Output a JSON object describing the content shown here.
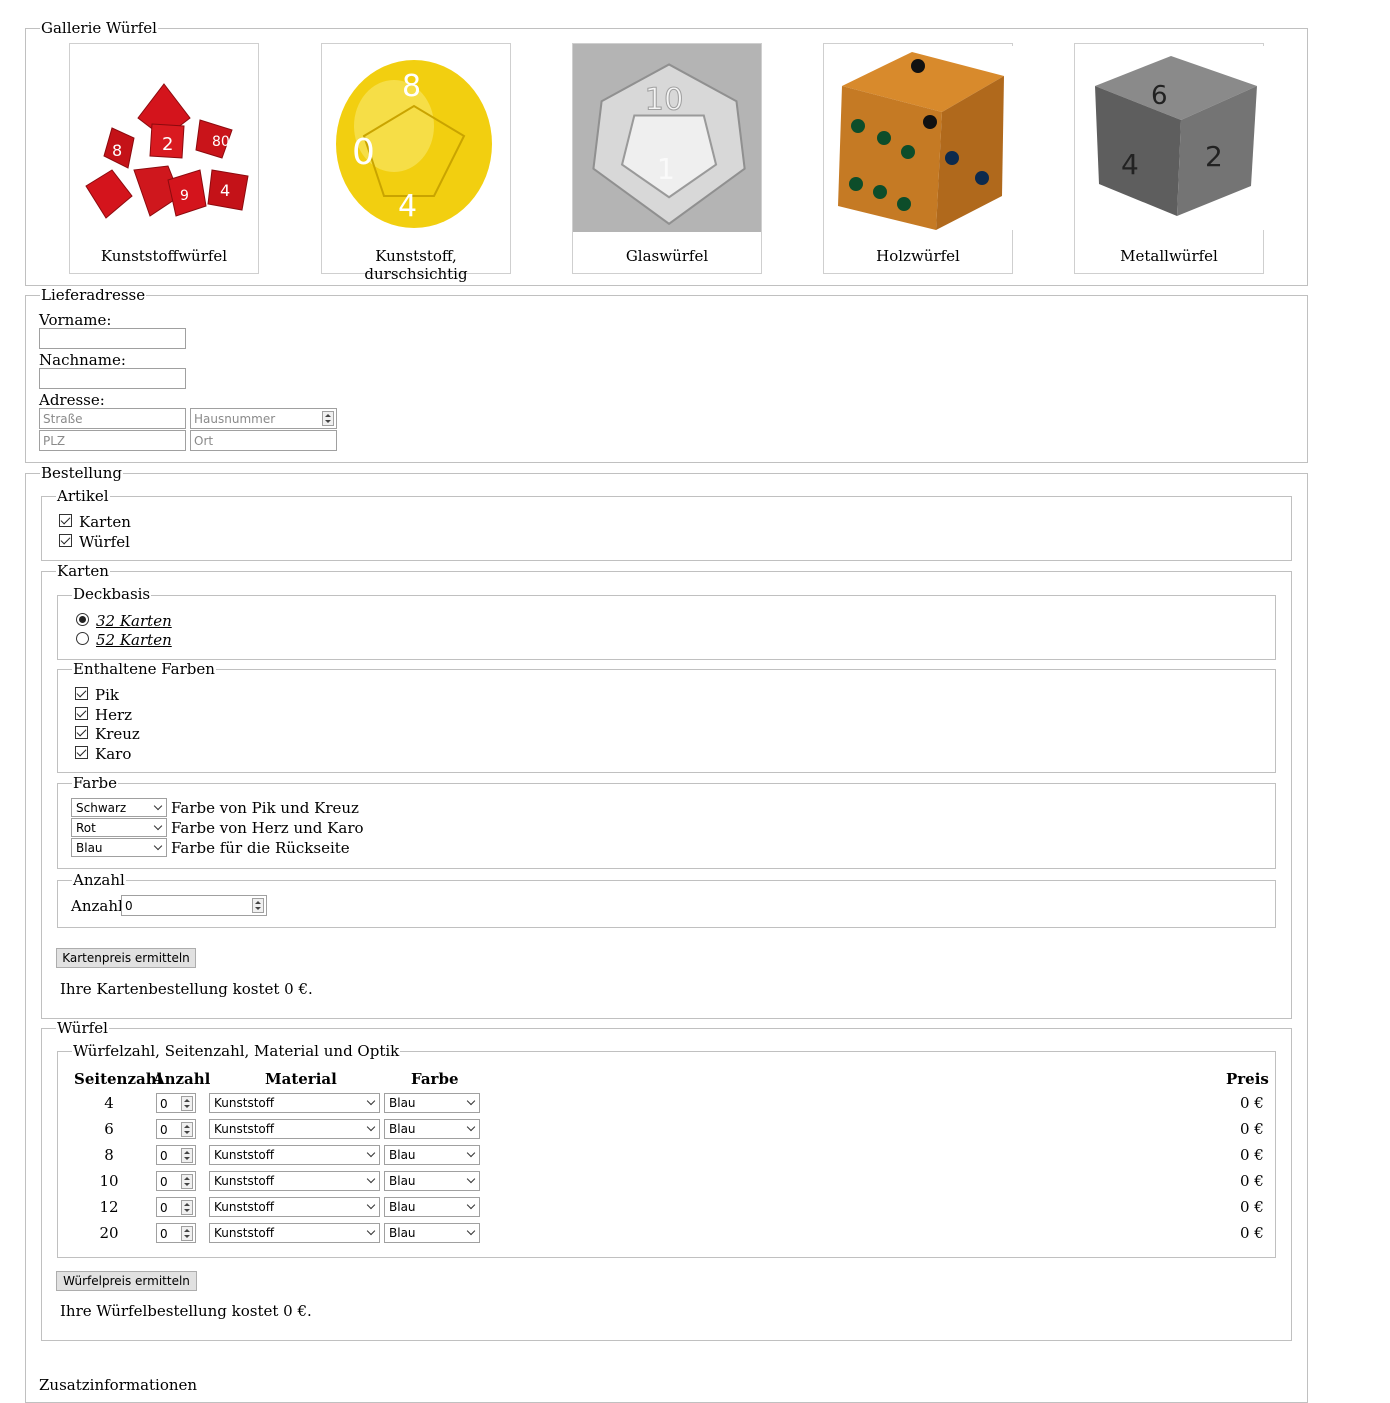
{
  "gallery": {
    "legend": "Gallerie Würfel",
    "items": [
      {
        "caption": "Kunststoffwürfel",
        "color": "#d4141c"
      },
      {
        "caption": "Kunststoff, durschsichtig",
        "color": "#f2cf10"
      },
      {
        "caption": "Glaswürfel",
        "color": "#c8c8c8"
      },
      {
        "caption": "Holzwürfel",
        "color": "#c57a24"
      },
      {
        "caption": "Metallwürfel",
        "color": "#6a6a6a"
      }
    ]
  },
  "address": {
    "legend": "Lieferadresse",
    "firstname_label": "Vorname:",
    "lastname_label": "Nachname:",
    "address_label": "Adresse:",
    "street_placeholder": "Straße",
    "number_placeholder": "Hausnummer",
    "zip_placeholder": "PLZ",
    "city_placeholder": "Ort"
  },
  "order": {
    "legend": "Bestellung",
    "articles": {
      "legend": "Artikel",
      "items": [
        {
          "label": "Karten",
          "checked": true
        },
        {
          "label": "Würfel",
          "checked": true
        }
      ]
    },
    "cards": {
      "legend": "Karten",
      "deck": {
        "legend": "Deckbasis",
        "options": [
          {
            "label": "32 Karten",
            "selected": true
          },
          {
            "label": "52 Karten",
            "selected": false
          }
        ]
      },
      "suits": {
        "legend": "Enthaltene Farben",
        "items": [
          {
            "label": "Pik",
            "checked": true
          },
          {
            "label": "Herz",
            "checked": true
          },
          {
            "label": "Kreuz",
            "checked": true
          },
          {
            "label": "Karo",
            "checked": true
          }
        ]
      },
      "colors": {
        "legend": "Farbe",
        "rows": [
          {
            "value": "Schwarz",
            "label": "Farbe von Pik und Kreuz"
          },
          {
            "value": "Rot",
            "label": "Farbe von Herz und Karo"
          },
          {
            "value": "Blau",
            "label": "Farbe für die Rückseite"
          }
        ]
      },
      "quantity": {
        "legend": "Anzahl",
        "label": "Anzahl",
        "value": "0"
      },
      "button": "Kartenpreis ermitteln",
      "result": "Ihre Kartenbestellung kostet 0 €."
    },
    "dice": {
      "legend": "Würfel",
      "inner_legend": "Würfelzahl, Seitenzahl, Material und Optik",
      "headers": {
        "sides": "Seitenzahl",
        "count": "Anzahl",
        "material": "Material",
        "color": "Farbe",
        "price": "Preis"
      },
      "rows": [
        {
          "sides": "4",
          "count": "0",
          "material": "Kunststoff",
          "color": "Blau",
          "price": "0 €"
        },
        {
          "sides": "6",
          "count": "0",
          "material": "Kunststoff",
          "color": "Blau",
          "price": "0 €"
        },
        {
          "sides": "8",
          "count": "0",
          "material": "Kunststoff",
          "color": "Blau",
          "price": "0 €"
        },
        {
          "sides": "10",
          "count": "0",
          "material": "Kunststoff",
          "color": "Blau",
          "price": "0 €"
        },
        {
          "sides": "12",
          "count": "0",
          "material": "Kunststoff",
          "color": "Blau",
          "price": "0 €"
        },
        {
          "sides": "20",
          "count": "0",
          "material": "Kunststoff",
          "color": "Blau",
          "price": "0 €"
        }
      ],
      "button": "Würfelpreis ermitteln",
      "result": "Ihre Würfelbestellung kostet 0 €."
    }
  },
  "extra": {
    "label": "Zusatzinformationen"
  }
}
